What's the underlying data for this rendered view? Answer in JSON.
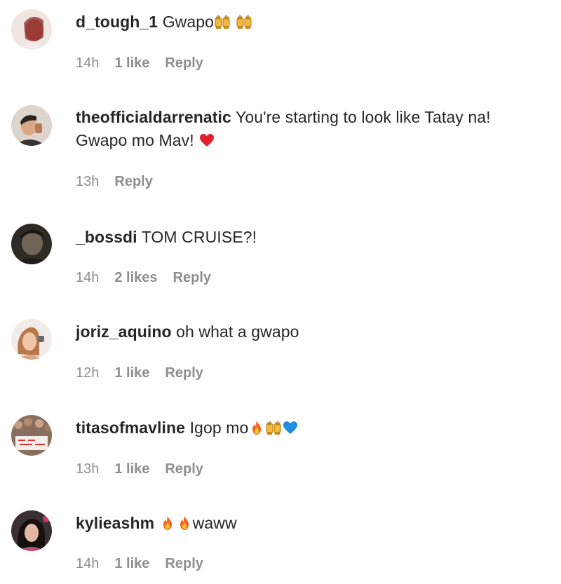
{
  "comments": [
    {
      "username": "d_tough_1",
      "text": "Gwapo",
      "emojis_after": [
        "raising-hands-icon",
        "raising-hands-icon"
      ],
      "time": "14h",
      "likes": "1 like",
      "reply": "Reply"
    },
    {
      "username": "theofficialdarrenatic",
      "text": "You're starting to look like Tatay na!",
      "text_line2": "Gwapo mo Mav!",
      "emojis_after": [
        "red-heart-icon"
      ],
      "time": "13h",
      "likes": "",
      "reply": "Reply"
    },
    {
      "username": "_bossdi",
      "text": "TOM CRUISE?!",
      "time": "14h",
      "likes": "2 likes",
      "reply": "Reply"
    },
    {
      "username": "joriz_aquino",
      "text": "oh what a gwapo",
      "time": "12h",
      "likes": "1 like",
      "reply": "Reply"
    },
    {
      "username": "titasofmavline",
      "text": "Igop mo",
      "emojis_after": [
        "fire-icon",
        "raising-hands-icon",
        "blue-heart-icon"
      ],
      "time": "13h",
      "likes": "1 like",
      "reply": "Reply"
    },
    {
      "username": "kylieashm",
      "text": "waww",
      "emojis_before": [
        "fire-icon",
        "fire-icon"
      ],
      "time": "14h",
      "likes": "1 like",
      "reply": "Reply"
    }
  ]
}
